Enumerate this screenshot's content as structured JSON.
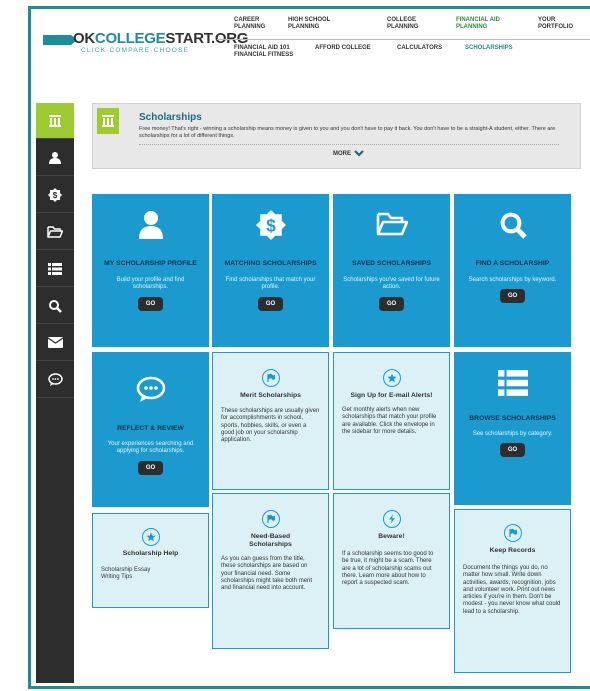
{
  "logo": {
    "ok": "OK",
    "college": "COLLEGE",
    "start": "START.ORG",
    "tagline": "CLICK·COMPARE·CHOOSE"
  },
  "topnav": [
    "CAREER PLANNING",
    "HIGH SCHOOL PLANNING",
    "COLLEGE PLANNING",
    "FINANCIAL AID PLANNING",
    "YOUR PORTFOLIO"
  ],
  "subnav": [
    "FINANCIAL AID 101 FINANCIAL FITNESS",
    "AFFORD COLLEGE",
    "CALCULATORS",
    "SCHOLARSHIPS"
  ],
  "banner": {
    "title": "Scholarships",
    "desc": "Free money! That's right - winning a scholarship means money is given to you and you don't have to pay it back. You don't have to be a straight-A student, either. There are scholarships for a lot of different things.",
    "more": "MORE"
  },
  "cards": {
    "profile": {
      "title": "MY SCHOLARSHIP PROFILE",
      "desc": "Build your profile and find scholarships.",
      "go": "GO"
    },
    "matching": {
      "title": "MATCHING SCHOLARSHIPS",
      "desc": "Find scholarships that match your profile.",
      "go": "GO"
    },
    "saved": {
      "title": "SAVED SCHOLARSHIPS",
      "desc": "Scholarships you've saved for future action.",
      "go": "GO"
    },
    "find": {
      "title": "FIND A SCHOLARSHIP",
      "desc": "Search scholarships by keyword.",
      "go": "GO"
    },
    "reflect": {
      "title": "REFLECT & REVIEW",
      "desc": "Your experiences searching and applying for scholarships.",
      "go": "GO"
    },
    "merit": {
      "title": "Merit Scholarships",
      "desc": "These scholarships are usually given for accomplishments in school, sports, hobbies, skills, or even a good job on your scholarship application."
    },
    "signup": {
      "title": "Sign Up for E-mail Alerts!",
      "desc": "Get monthly alerts when new scholarships that match your profile are available. Click the envelope in the sidebar for more details."
    },
    "browse": {
      "title": "BROWSE SCHOLARSHIPS",
      "desc": "See scholarships by category.",
      "go": "GO"
    },
    "help": {
      "title": "Scholarship Help",
      "desc": "Scholarship Essay Writing Tips"
    },
    "need": {
      "title": "Need-Based Scholarships",
      "desc": "As you can guess from the title, these scholarships are based on your financial need. Some scholarships might take both merit and financial need into account."
    },
    "beware": {
      "title": "Beware!",
      "desc": "If a scholarship seems too good to be true, it might be a scam. There are a lot of scholarship scams out there. Learn more about how to report a suspected scam."
    },
    "records": {
      "title": "Keep Records",
      "desc": "Document the things you do, no matter how small. Write down activities, awards, recognition, jobs and volunteer work. Print out news articles if you're in them. Don't be modest - you never know what could lead to a scholarship."
    }
  },
  "colors": {
    "accent": "#1b9ad0",
    "active": "#9ccc31",
    "sidebar": "#2d2d2d",
    "frame": "#1e8d9a"
  }
}
